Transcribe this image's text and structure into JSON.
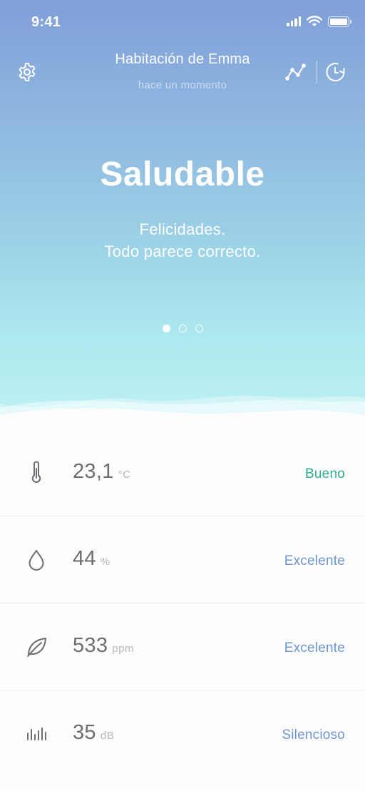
{
  "status_bar": {
    "time": "9:41"
  },
  "header": {
    "room_name": "Habitación de Emma",
    "updated": "hace un momento"
  },
  "hero": {
    "status": "Saludable",
    "message_line1": "Felicidades.",
    "message_line2": "Todo parece correcto.",
    "pages": 3,
    "active_page": 1
  },
  "metrics": [
    {
      "icon": "thermometer-icon",
      "value": "23,1",
      "unit": "°C",
      "rating": "Bueno",
      "rating_color": "#2fae8e"
    },
    {
      "icon": "humidity-drop-icon",
      "value": "44",
      "unit": "%",
      "rating": "Excelente",
      "rating_color": "#6f94d2"
    },
    {
      "icon": "leaf-icon",
      "value": "533",
      "unit": "ppm",
      "rating": "Excelente",
      "rating_color": "#6f94d2"
    },
    {
      "icon": "sound-level-icon",
      "value": "35",
      "unit": "dB",
      "rating": "Silencioso",
      "rating_color": "#6f94d2"
    }
  ],
  "colors": {
    "gradient_top": "#7f9fd8",
    "gradient_bottom": "#bff1f4",
    "good": "#2fae8e",
    "excellent": "#6f94d2"
  }
}
